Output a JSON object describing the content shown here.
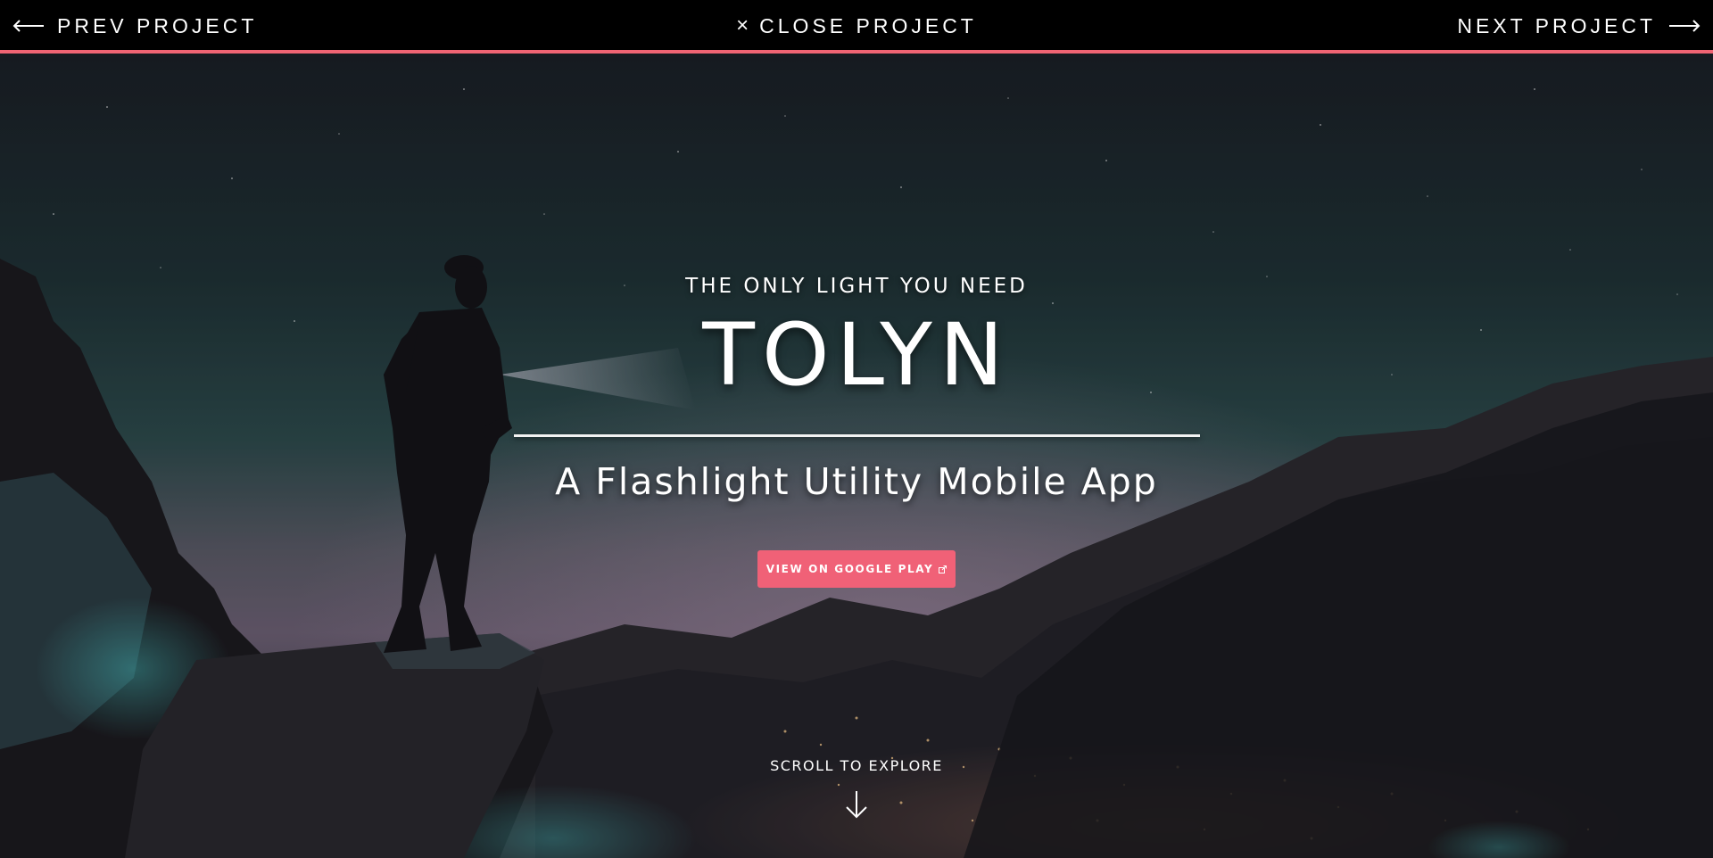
{
  "nav": {
    "prev_label": "PREV PROJECT",
    "close_label": "CLOSE PROJECT",
    "next_label": "NEXT PROJECT",
    "close_icon": "×",
    "accent_color": "#f06473"
  },
  "hero": {
    "tagline": "THE ONLY LIGHT YOU NEED",
    "title": "TOLYN",
    "subtitle": "A Flashlight Utility Mobile App",
    "cta_label": "VIEW ON GOOGLE PLAY",
    "cta_icon": "external-link-icon",
    "cta_color": "#f06177",
    "scroll_label": "SCROLL TO EXPLORE",
    "scroll_icon": "arrow-down-icon"
  }
}
